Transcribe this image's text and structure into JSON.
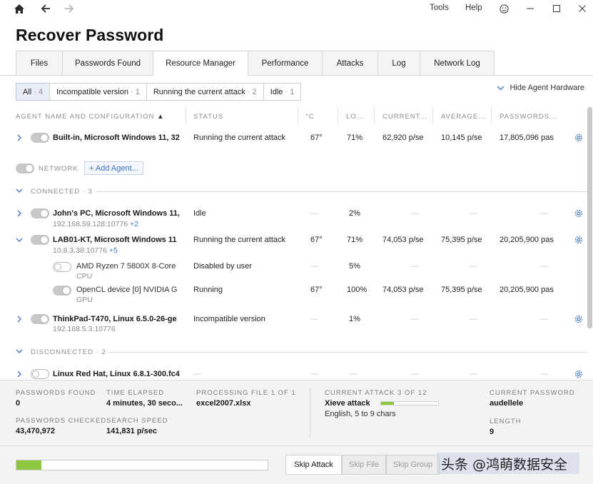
{
  "topbar": {
    "menu_tools": "Tools",
    "menu_help": "Help",
    "icons": [
      "home-icon",
      "back-arrow-icon",
      "forward-arrow-icon",
      "smiley-icon",
      "minimize-icon",
      "maximize-icon",
      "close-icon"
    ]
  },
  "page_title": "Recover Password",
  "tabs": [
    "Files",
    "Passwords Found",
    "Resource Manager",
    "Performance",
    "Attacks",
    "Log",
    "Network Log"
  ],
  "active_tab": "Resource Manager",
  "filters": [
    {
      "label": "All",
      "count": "· 4"
    },
    {
      "label": "Incompatible version",
      "count": "· 1"
    },
    {
      "label": "Running the current attack",
      "count": "· 2"
    },
    {
      "label": "Idle",
      "count": "· 1"
    }
  ],
  "hide_hardware_label": "Hide Agent Hardware",
  "columns": {
    "agent": "AGENT NAME AND CONFIGURATION",
    "status": "STATUS",
    "temp": "°C",
    "load": "LO...",
    "current": "CURRENT...",
    "average": "AVERAGE...",
    "passwords": "PASSWORDS..."
  },
  "builtin": {
    "name": "Built-in, Microsoft Windows 11, 32",
    "status": "Running the current attack",
    "temp": "67°",
    "load": "71%",
    "current": "62,920 p/se",
    "average": "10,145 p/se",
    "passwords": "17,805,096 pas"
  },
  "network": {
    "label": "NETWORK",
    "add_agent": "+ Add Agent..."
  },
  "connected_label": "CONNECTED · 3",
  "disconnected_label": "DISCONNECTED · 2",
  "dash": "—",
  "agents": {
    "johns_pc": {
      "name": "John's PC, Microsoft Windows 11,",
      "address": "192.168.59.128:10776",
      "more": "+2",
      "status": "Idle",
      "load": "2%"
    },
    "lab01": {
      "name": "LAB01-KT, Microsoft Windows 11",
      "address": "10.8.3.38:10776",
      "more": "+5",
      "status": "Running the current attack",
      "temp": "67°",
      "load": "71%",
      "current": "74,053 p/se",
      "average": "75,395 p/se",
      "passwords": "20,205,900 pas"
    },
    "cpu": {
      "name": "AMD Ryzen 7 5800X 8-Core",
      "type": "CPU",
      "status": "Disabled by user",
      "load": "5%"
    },
    "gpu": {
      "name": "OpenCL device [0] NVIDIA G",
      "type": "GPU",
      "status": "Running",
      "temp": "67°",
      "load": "100%",
      "current": "74,053 p/se",
      "average": "75,395 p/se",
      "passwords": "20,205,900 pas"
    },
    "thinkpad": {
      "name": "ThinkPad-T470, Linux 6.5.0-26-ge",
      "address": "192.168.5.3:10776",
      "status": "Incompatible version",
      "load": "1%"
    },
    "linux_rh": {
      "name": "Linux Red Hat, Linux 6.8.1-300.fc4"
    }
  },
  "status": {
    "passwords_found_label": "PASSWORDS FOUND",
    "passwords_found": "0",
    "time_elapsed_label": "TIME ELAPSED",
    "time_elapsed": "4 minutes, 30 seco...",
    "processing_label": "PROCESSING FILE 1 OF 1",
    "processing_file": "excel2007.xlsx",
    "passwords_checked_label": "PASSWORDS CHECKED",
    "passwords_checked": "43,470,972",
    "search_speed_label": "SEARCH SPEED",
    "search_speed": "141,831 p/sec",
    "current_attack_label": "CURRENT ATTACK 3 OF 12",
    "current_attack": "Xieve attack",
    "attack_detail": "English, 5 to 9 chars",
    "attack_progress": 0.22,
    "current_password_label": "CURRENT PASSWORD",
    "current_password": "audellele",
    "length_label": "LENGTH",
    "length": "9",
    "overall_progress": 0.1
  },
  "buttons": {
    "skip_attack": "Skip Attack",
    "skip_file": "Skip File",
    "skip_group": "Skip Group"
  },
  "watermark": "头条 @鸿萌数据安全",
  "colors": {
    "progress": "#8dc63f",
    "link": "#3d74c6"
  }
}
